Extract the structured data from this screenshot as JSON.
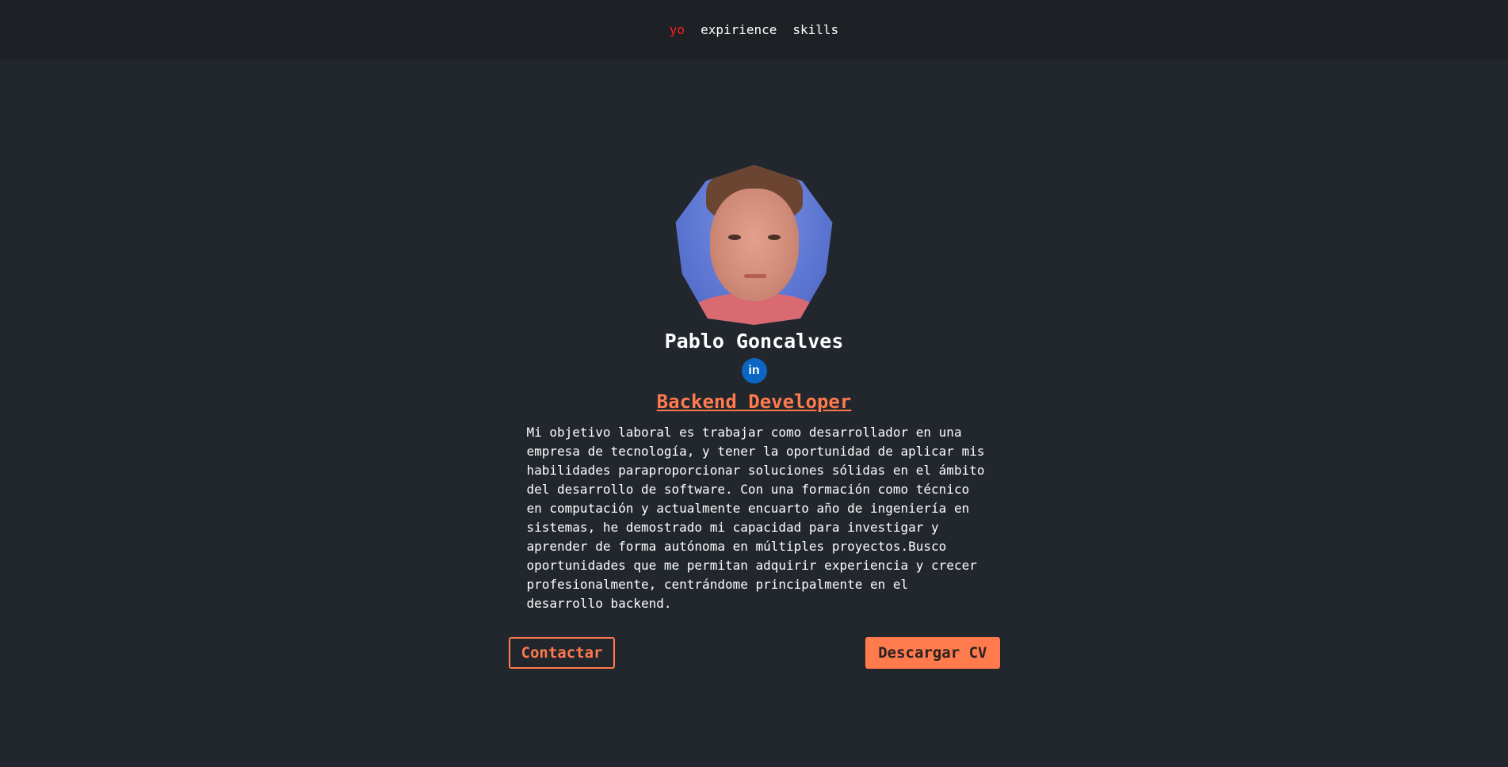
{
  "nav": {
    "items": [
      {
        "label": "yo",
        "active": true
      },
      {
        "label": "expirience",
        "active": false
      },
      {
        "label": "skills",
        "active": false
      }
    ]
  },
  "profile": {
    "name": "Pablo Goncalves",
    "linkedin_label": "in",
    "role": "Backend Developer",
    "bio": "Mi objetivo laboral es trabajar como desarrollador en una empresa de tecnología, y tener la oportunidad de aplicar mis habilidades paraproporcionar soluciones sólidas en el ámbito del desarrollo de software. Con una formación como técnico en computación y actualmente encuarto año de ingeniería en sistemas, he demostrado mi capacidad para investigar y aprender de forma autónoma en múltiples proyectos.Busco oportunidades que me permitan adquirir experiencia y crecer profesionalmente, centrándome principalmente en el desarrollo backend."
  },
  "actions": {
    "contact_label": "Contactar",
    "download_label": "Descargar CV"
  },
  "colors": {
    "background": "#22262d",
    "nav_background": "#1d2025",
    "accent": "#ff7a4d",
    "active_nav": "#ff1f1f",
    "linkedin": "#0a66c2"
  }
}
